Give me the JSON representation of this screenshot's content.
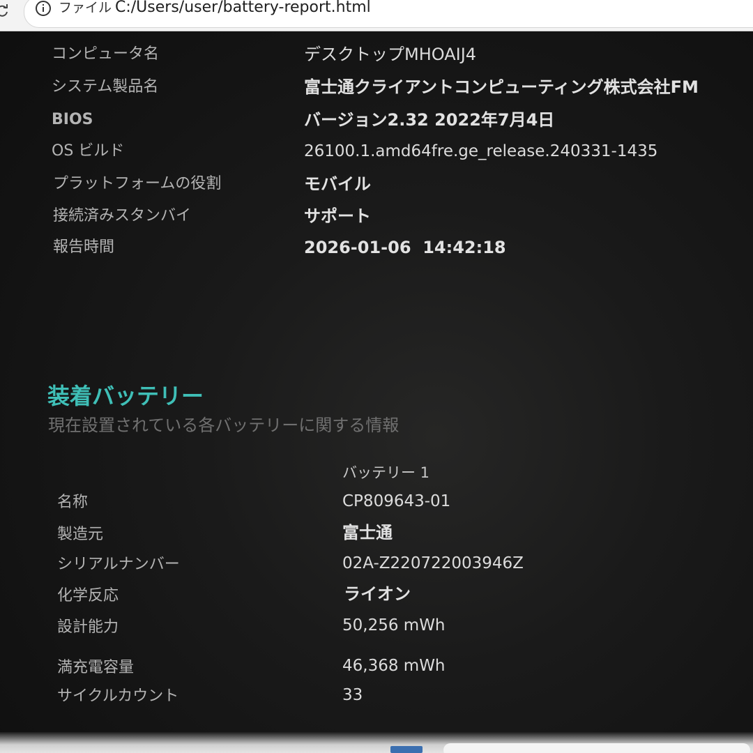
{
  "browser": {
    "scheme_label": "ファイル",
    "url": "C:/Users/user/battery-report.html"
  },
  "system_info": [
    {
      "label": "コンピュータ名",
      "value": "デスクトップMHOAIJ4"
    },
    {
      "label": "システム製品名",
      "value": "富士通クライアントコンピューティング株式会社FM"
    },
    {
      "label": "BIOS",
      "value": "バージョン2.32 2022年7月4日"
    },
    {
      "label": "OS ビルド",
      "value": "26100.1.amd64fre.ge_release.240331-1435"
    },
    {
      "label": "プラットフォームの役割",
      "value": "モバイル"
    },
    {
      "label": "接続済みスタンバイ",
      "value": "サポート"
    },
    {
      "label": "報告時間",
      "value": "2026-01-06  14:42:18"
    }
  ],
  "installed_batteries": {
    "title": "装着バッテリー",
    "subtitle": "現在設置されている各バッテリーに関する情報",
    "column_header": "バッテリー 1",
    "rows": [
      {
        "label": "名称",
        "value": "CP809643-01"
      },
      {
        "label": "製造元",
        "value": "富士通"
      },
      {
        "label": "シリアルナンバー",
        "value": "02A-Z220722003946Z"
      },
      {
        "label": "化学反応",
        "value": "ライオン"
      },
      {
        "label": "設計能力",
        "value": "50,256 mWh"
      },
      {
        "label": "満充電容量",
        "value": "46,368 mWh"
      },
      {
        "label": "サイクルカウント",
        "value": "33"
      }
    ]
  },
  "colors": {
    "section_title": "#3fbfb7",
    "background": "#141414"
  }
}
